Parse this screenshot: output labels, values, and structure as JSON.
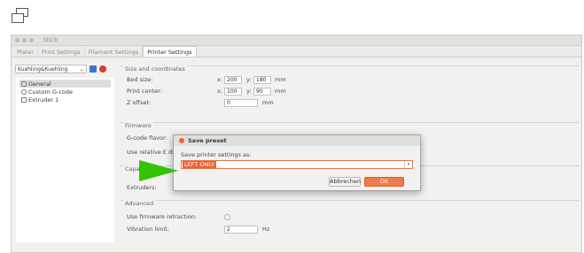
{
  "window": {
    "title": "Slic3r"
  },
  "tabs": [
    {
      "label": "Plater"
    },
    {
      "label": "Print Settings"
    },
    {
      "label": "Filament Settings"
    },
    {
      "label": "Printer Settings"
    }
  ],
  "sidebar": {
    "preset": "Kuehling&Kuehling",
    "tree": [
      {
        "label": "General"
      },
      {
        "label": "Custom G-code"
      },
      {
        "label": "Extruder 1"
      }
    ]
  },
  "size": {
    "title": "Size and coordinates",
    "bed_label": "Bed size:",
    "bed_x": "200",
    "bed_y": "180",
    "bed_unit": "mm",
    "center_label": "Print center:",
    "center_x": "100",
    "center_y": "90",
    "center_unit": "mm",
    "zoffset_label": "Z offset:",
    "zoffset": "0",
    "zoffset_unit": "mm",
    "x_label": "x:",
    "y_label": "y:"
  },
  "firmware": {
    "title": "Firmware",
    "flavor_label": "G-code flavor:",
    "relative_label": "Use relative E distances:"
  },
  "capabilities": {
    "title": "Capabilities",
    "extruders_label": "Extruders:"
  },
  "advanced": {
    "title": "Advanced",
    "retraction_label": "Use firmware retraction:",
    "vibration_label": "Vibration limit:",
    "vibration": "2",
    "vibration_unit": "Hz"
  },
  "dialog": {
    "title": "Save preset",
    "prompt": "Save printer settings as:",
    "value": "LEFT ONLY",
    "cancel": "Abbrechen",
    "ok": "OK"
  },
  "colors": {
    "accent": "#e8643a",
    "pointer": "#33c400"
  }
}
